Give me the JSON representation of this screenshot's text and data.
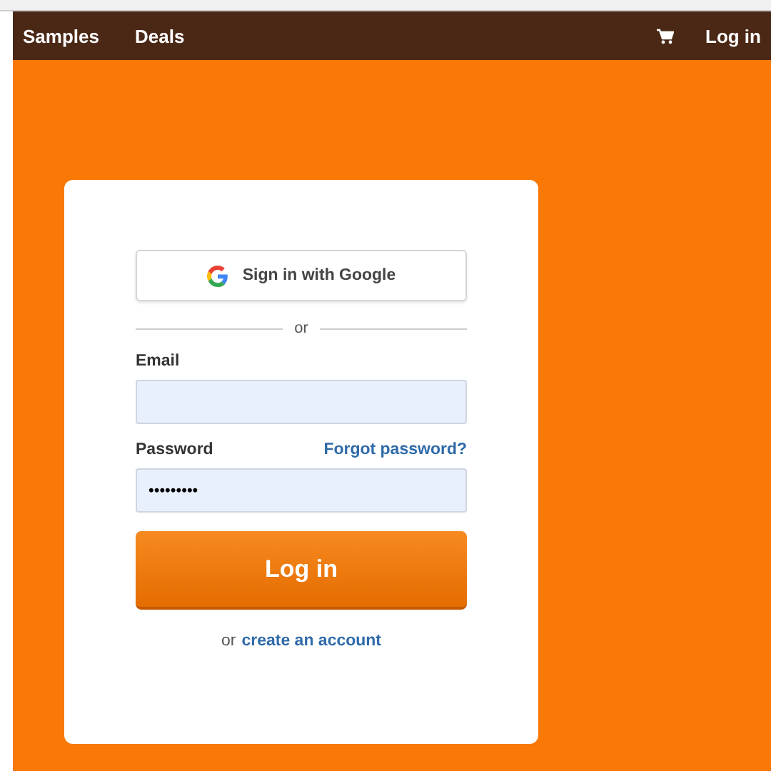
{
  "navbar": {
    "links": [
      "Samples",
      "Deals"
    ],
    "login": "Log in"
  },
  "login_form": {
    "google_button": "Sign in with Google",
    "divider": "or",
    "email": {
      "label": "Email"
    },
    "password": {
      "label": "Password",
      "value": "•••••••••",
      "forgot_link": "Forgot password?"
    },
    "submit": "Log in",
    "signup": {
      "prefix": "or",
      "link": "create an account"
    }
  }
}
